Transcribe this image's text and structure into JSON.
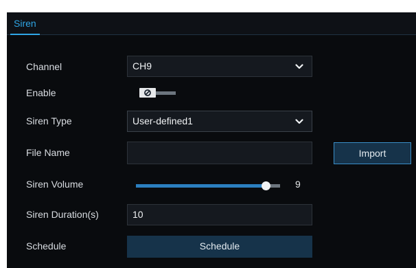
{
  "tab": {
    "label": "Siren"
  },
  "channel": {
    "label": "Channel",
    "value": "CH9"
  },
  "enable": {
    "label": "Enable",
    "enabled": false
  },
  "siren_type": {
    "label": "Siren Type",
    "value": "User-defined1"
  },
  "file_name": {
    "label": "File Name",
    "value": "",
    "import_label": "Import"
  },
  "siren_volume": {
    "label": "Siren Volume",
    "value": "9",
    "max": 10,
    "fraction": 0.9
  },
  "siren_duration": {
    "label": "Siren Duration(s)",
    "value": "10"
  },
  "schedule": {
    "label": "Schedule",
    "button_label": "Schedule"
  },
  "colors": {
    "accent": "#2fa6e6",
    "panel": "#090b0e",
    "button": "#16334a",
    "slider_fill": "#2b7fc0"
  },
  "icons": {
    "select_arrow": "chevron-down-icon",
    "toggle_off": "disabled-circle-icon"
  }
}
